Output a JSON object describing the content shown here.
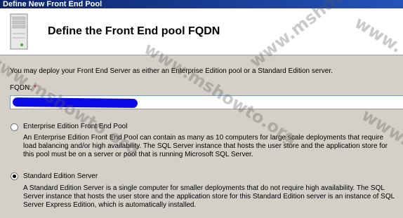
{
  "window": {
    "title": "Define New Front End Pool"
  },
  "header": {
    "icon": "server-icon",
    "title": "Define the Front End pool FQDN"
  },
  "intro_text": "You may deploy your Front End Server as either an Enterprise Edition pool or a Standard Edition server.",
  "fqdn": {
    "label": "FQDN:",
    "required_marker": "*",
    "value": ""
  },
  "options": [
    {
      "label": "Enterprise Edition Front End Pool",
      "selected": false,
      "description": "An Enterprise Edition Front End Pool can contain as many as 10 computers for large scale deployments that require load balancing and/or high availability.  The SQL Server instance that hosts the user store and the application store for this pool must be on a server or pool that is running Microsoft SQL Server."
    },
    {
      "label": "Standard Edition Server",
      "selected": true,
      "description": "A Standard Edition Server is a single computer for smaller deployments that do not require high availability. The SQL Server instance that hosts the user store and the application store for this Standard Edition server is an instance of SQL Server Express Edition, which is automatically installed."
    }
  ],
  "watermark": {
    "text_1": "www.mshowto.org",
    "text_2": "www.mshowto.org",
    "text_3": "www.mshowto.org",
    "text_4": "www.",
    "text_5": "www."
  },
  "colors": {
    "title_bar": "#0b246a",
    "required": "#cc0000",
    "redaction": "#0a0ae6"
  }
}
